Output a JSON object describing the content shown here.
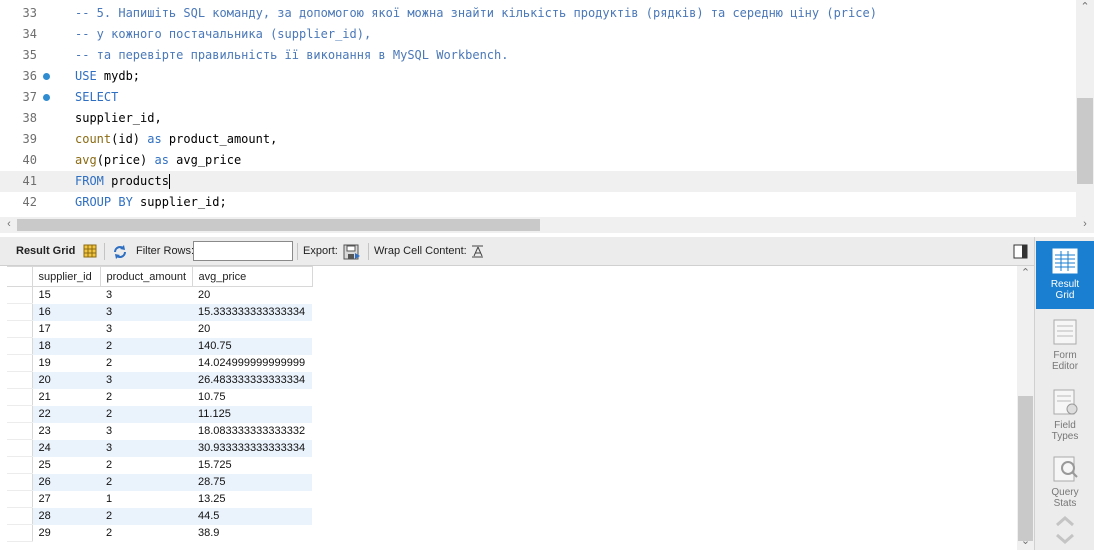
{
  "editor": {
    "lines": [
      {
        "num": "33",
        "marker": false,
        "current": false,
        "tokens": [
          {
            "t": "-- 5. Напишіть SQL команду, за допомогою якої можна знайти кількість продуктів (рядків) та середню ціну (price)",
            "c": "cmt"
          }
        ]
      },
      {
        "num": "34",
        "marker": false,
        "current": false,
        "tokens": [
          {
            "t": "-- у кожного постачальника (supplier_id),",
            "c": "cmt"
          }
        ]
      },
      {
        "num": "35",
        "marker": false,
        "current": false,
        "tokens": [
          {
            "t": "-- та перевірте правильність її виконання в MySQL Workbench.",
            "c": "cmt"
          }
        ]
      },
      {
        "num": "36",
        "marker": true,
        "current": false,
        "tokens": [
          {
            "t": "USE",
            "c": "kw"
          },
          {
            "t": " mydb;",
            "c": ""
          }
        ]
      },
      {
        "num": "37",
        "marker": true,
        "current": false,
        "tokens": [
          {
            "t": "SELECT",
            "c": "kw"
          }
        ]
      },
      {
        "num": "38",
        "marker": false,
        "current": false,
        "tokens": [
          {
            "t": "supplier_id,",
            "c": ""
          }
        ]
      },
      {
        "num": "39",
        "marker": false,
        "current": false,
        "tokens": [
          {
            "t": "count",
            "c": "fn"
          },
          {
            "t": "(id) ",
            "c": ""
          },
          {
            "t": "as",
            "c": "kw"
          },
          {
            "t": " product_amount,",
            "c": ""
          }
        ]
      },
      {
        "num": "40",
        "marker": false,
        "current": false,
        "tokens": [
          {
            "t": "avg",
            "c": "fn"
          },
          {
            "t": "(price) ",
            "c": ""
          },
          {
            "t": "as",
            "c": "kw"
          },
          {
            "t": " avg_price",
            "c": ""
          }
        ]
      },
      {
        "num": "41",
        "marker": false,
        "current": true,
        "tokens": [
          {
            "t": "FROM",
            "c": "kw"
          },
          {
            "t": " products",
            "c": ""
          }
        ]
      },
      {
        "num": "42",
        "marker": false,
        "current": false,
        "tokens": [
          {
            "t": "GROUP BY",
            "c": "kw"
          },
          {
            "t": " supplier_id;",
            "c": ""
          }
        ]
      }
    ]
  },
  "toolbar": {
    "result_grid_label": "Result Grid",
    "filter_rows_label": "Filter Rows:",
    "filter_value": "",
    "export_label": "Export:",
    "wrap_label": "Wrap Cell Content:"
  },
  "grid": {
    "columns": [
      "supplier_id",
      "product_amount",
      "avg_price"
    ],
    "rows": [
      [
        "15",
        "3",
        "20"
      ],
      [
        "16",
        "3",
        "15.333333333333334"
      ],
      [
        "17",
        "3",
        "20"
      ],
      [
        "18",
        "2",
        "140.75"
      ],
      [
        "19",
        "2",
        "14.024999999999999"
      ],
      [
        "20",
        "3",
        "26.483333333333334"
      ],
      [
        "21",
        "2",
        "10.75"
      ],
      [
        "22",
        "2",
        "11.125"
      ],
      [
        "23",
        "3",
        "18.083333333333332"
      ],
      [
        "24",
        "3",
        "30.933333333333334"
      ],
      [
        "25",
        "2",
        "15.725"
      ],
      [
        "26",
        "2",
        "28.75"
      ],
      [
        "27",
        "1",
        "13.25"
      ],
      [
        "28",
        "2",
        "44.5"
      ],
      [
        "29",
        "2",
        "38.9"
      ]
    ]
  },
  "side_panel": {
    "result_grid": "Result Grid",
    "form_editor": "Form Editor",
    "field_types": "Field Types",
    "query_stats": "Query Stats"
  }
}
